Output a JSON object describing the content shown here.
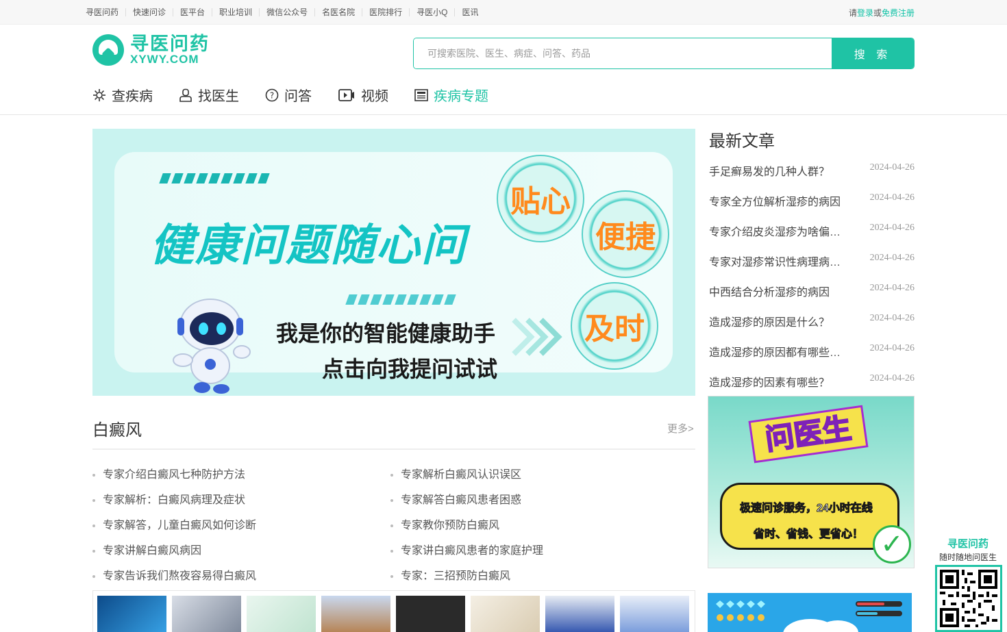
{
  "topbar": {
    "links": [
      "寻医问药",
      "快速问诊",
      "医平台",
      "职业培训",
      "微信公众号",
      "名医名院",
      "医院排行",
      "寻医小Q",
      "医讯"
    ],
    "login_prefix": "请",
    "login_label": "登录",
    "login_or": "或",
    "register_label": "免费注册"
  },
  "logo": {
    "cn": "寻医问药",
    "en": "XYWY.COM"
  },
  "search": {
    "placeholder": "可搜索医院、医生、病症、问答、药品",
    "button": "搜 索"
  },
  "nav": [
    {
      "label": "查疾病",
      "icon": "gear-flower-icon",
      "active": false
    },
    {
      "label": "找医生",
      "icon": "doctor-icon",
      "active": false
    },
    {
      "label": "问答",
      "icon": "question-icon",
      "active": false
    },
    {
      "label": "视频",
      "icon": "video-icon",
      "active": false
    },
    {
      "label": "疾病专题",
      "icon": "newspaper-icon",
      "active": true
    }
  ],
  "banner": {
    "title": "健康问题随心问",
    "line1": "我是你的智能健康助手",
    "line2": "点击向我提问试试",
    "badges": [
      "贴心",
      "便捷",
      "及时"
    ]
  },
  "section": {
    "title": "白癜风",
    "more": "更多>",
    "left": [
      "专家介绍白癜风七种防护方法",
      "专家解析：白癜风病理及症状",
      "专家解答，儿童白癜风如何诊断",
      "专家讲解白癜风病因",
      "专家告诉我们熬夜容易得白癜风"
    ],
    "right": [
      "专家解析白癜风认识误区",
      "专家解答白癜风患者困惑",
      "专家教你预防白癜风",
      "专家讲白癜风患者的家庭护理",
      "专家：三招预防白癜风"
    ]
  },
  "sidebar": {
    "title": "最新文章",
    "articles": [
      {
        "title": "手足癣易发的几种人群？",
        "date": "2024-04-26"
      },
      {
        "title": "专家全方位解析湿疹的病因",
        "date": "2024-04-26"
      },
      {
        "title": "专家介绍皮炎湿疹为啥偏…",
        "date": "2024-04-26"
      },
      {
        "title": "专家对湿疹常识性病理病…",
        "date": "2024-04-26"
      },
      {
        "title": "中西结合分析湿疹的病因",
        "date": "2024-04-26"
      },
      {
        "title": "造成湿疹的原因是什么？",
        "date": "2024-04-26"
      },
      {
        "title": "造成湿疹的原因都有哪些…",
        "date": "2024-04-26"
      },
      {
        "title": "造成湿疹的因素有哪些？",
        "date": "2024-04-26"
      }
    ]
  },
  "ad": {
    "title": "问医生",
    "line1": "极速问诊服务，24小时在线",
    "line2": "省时、省钱、更省心！"
  },
  "float": {
    "title": "寻医问药",
    "subtitle": "随时随地问医生"
  },
  "colors": {
    "brand": "#1fc3a5",
    "banner_bg": "#c9f3f0",
    "badge_text": "#ff8a1d"
  }
}
